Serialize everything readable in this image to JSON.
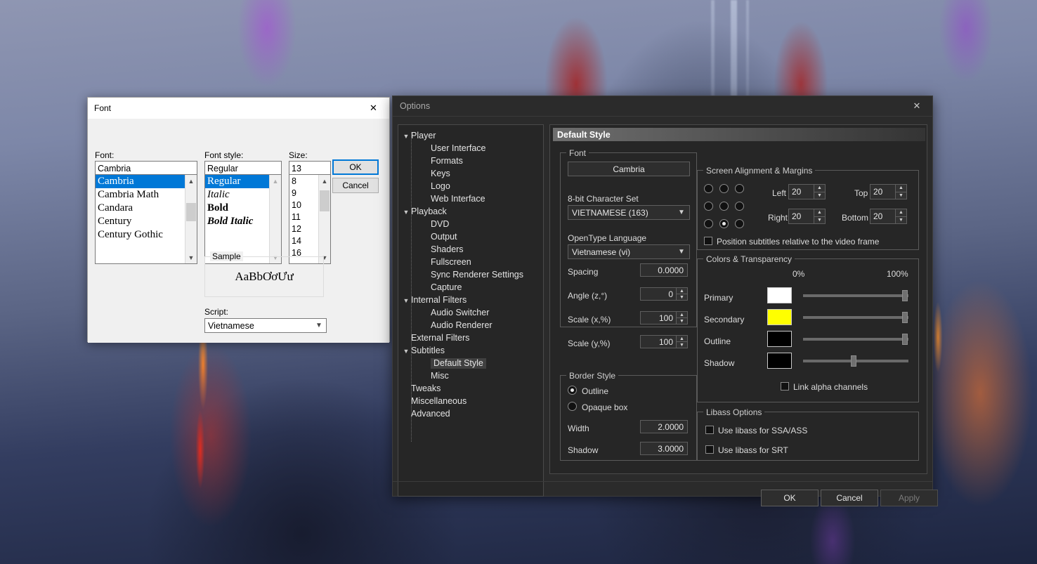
{
  "font_dialog": {
    "title": "Font",
    "close_icon": "close-icon",
    "font_label": "Font:",
    "font_value": "Cambria",
    "font_list": [
      "Cambria",
      "Cambria Math",
      "Candara",
      "Century",
      "Century Gothic"
    ],
    "font_selected_index": 0,
    "style_label": "Font style:",
    "style_value": "Regular",
    "style_list": [
      "Regular",
      "Italic",
      "Bold",
      "Bold Italic"
    ],
    "style_selected_index": 0,
    "size_label": "Size:",
    "size_value": "13",
    "size_list": [
      "8",
      "9",
      "10",
      "11",
      "12",
      "14",
      "16"
    ],
    "ok_label": "OK",
    "cancel_label": "Cancel",
    "sample_legend": "Sample",
    "sample_text": "AaBbƠơƯư",
    "script_label": "Script:",
    "script_value": "Vietnamese",
    "scroll_up_icon": "chevron-up-icon",
    "scroll_down_icon": "chevron-down-icon",
    "combo_chevron_icon": "chevron-down-icon"
  },
  "options_dialog": {
    "title": "Options",
    "close_icon": "close-icon",
    "tree": [
      {
        "label": "Player",
        "level": 0,
        "expanded": true,
        "chevron": "chevron-down-icon"
      },
      {
        "label": "User Interface",
        "level": 1
      },
      {
        "label": "Formats",
        "level": 1
      },
      {
        "label": "Keys",
        "level": 1
      },
      {
        "label": "Logo",
        "level": 1
      },
      {
        "label": "Web Interface",
        "level": 1
      },
      {
        "label": "Playback",
        "level": 0,
        "expanded": true,
        "chevron": "chevron-down-icon"
      },
      {
        "label": "DVD",
        "level": 1
      },
      {
        "label": "Output",
        "level": 1
      },
      {
        "label": "Shaders",
        "level": 1
      },
      {
        "label": "Fullscreen",
        "level": 1
      },
      {
        "label": "Sync Renderer Settings",
        "level": 1
      },
      {
        "label": "Capture",
        "level": 1
      },
      {
        "label": "Internal Filters",
        "level": 0,
        "expanded": true,
        "chevron": "chevron-down-icon"
      },
      {
        "label": "Audio Switcher",
        "level": 1
      },
      {
        "label": "Audio Renderer",
        "level": 1
      },
      {
        "label": "External Filters",
        "level": 0
      },
      {
        "label": "Subtitles",
        "level": 0,
        "expanded": true,
        "chevron": "chevron-down-icon"
      },
      {
        "label": "Default Style",
        "level": 1,
        "selected": true
      },
      {
        "label": "Misc",
        "level": 1
      },
      {
        "label": "Tweaks",
        "level": 0
      },
      {
        "label": "Miscellaneous",
        "level": 0
      },
      {
        "label": "Advanced",
        "level": 0
      }
    ],
    "panel_title": "Default Style",
    "font_group": {
      "legend": "Font",
      "font_button": "Cambria",
      "charset_label": "8-bit Character Set",
      "charset_value": "VIETNAMESE (163)",
      "otlang_label": "OpenType Language",
      "otlang_value": "Vietnamese (vi)",
      "spacing_label": "Spacing",
      "spacing_value": "0.0000",
      "angle_label": "Angle (z,°)",
      "angle_value": "0",
      "scale_x_label": "Scale (x,%)",
      "scale_x_value": "100",
      "scale_y_label": "Scale (y,%)",
      "scale_y_value": "100"
    },
    "border_group": {
      "legend": "Border Style",
      "outline_label": "Outline",
      "outline_selected": true,
      "opaque_label": "Opaque box",
      "opaque_selected": false,
      "width_label": "Width",
      "width_value": "2.0000",
      "shadow_label": "Shadow",
      "shadow_value": "3.0000"
    },
    "alignment_group": {
      "legend": "Screen Alignment & Margins",
      "selected_cell": 7,
      "left_label": "Left",
      "left_value": "20",
      "top_label": "Top",
      "top_value": "20",
      "right_label": "Right",
      "right_value": "20",
      "bottom_label": "Bottom",
      "bottom_value": "20",
      "relative_label": "Position subtitles relative to the video frame",
      "relative_checked": false
    },
    "colors_group": {
      "legend": "Colors & Transparency",
      "min_label": "0%",
      "max_label": "100%",
      "rows": [
        {
          "label": "Primary",
          "color": "#ffffff",
          "alpha": 100
        },
        {
          "label": "Secondary",
          "color": "#ffff00",
          "alpha": 100
        },
        {
          "label": "Outline",
          "color": "#000000",
          "alpha": 100
        },
        {
          "label": "Shadow",
          "color": "#000000",
          "alpha": 50
        }
      ],
      "link_label": "Link alpha channels",
      "link_checked": false
    },
    "libass_group": {
      "legend": "Libass Options",
      "ssa_label": "Use libass for SSA/ASS",
      "ssa_checked": false,
      "srt_label": "Use libass for SRT",
      "srt_checked": false
    },
    "ok_label": "OK",
    "cancel_label": "Cancel",
    "apply_label": "Apply",
    "apply_disabled": true
  }
}
